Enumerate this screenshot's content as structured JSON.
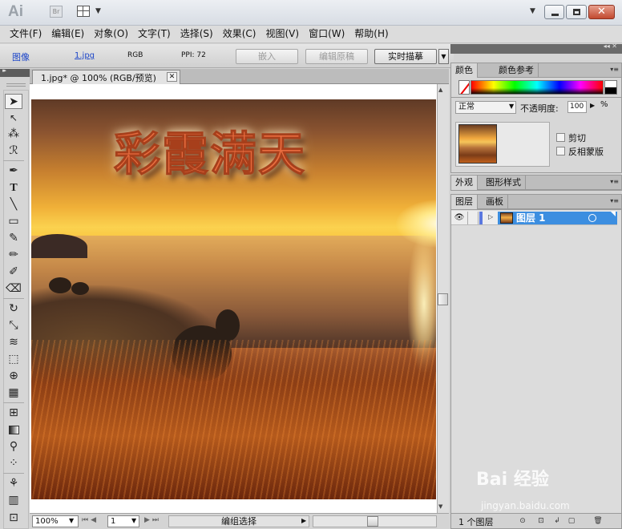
{
  "app": {
    "logo": "Ai",
    "bridge_label": "Br"
  },
  "window": {
    "close_glyph": "✕"
  },
  "menu": [
    "文件(F)",
    "编辑(E)",
    "对象(O)",
    "文字(T)",
    "选择(S)",
    "效果(C)",
    "视图(V)",
    "窗口(W)",
    "帮助(H)"
  ],
  "control_bar": {
    "object_type": "图像",
    "file_link": "1.jpg",
    "color_mode": "RGB",
    "ppi": "PPI: 72",
    "embed_label": "嵌入",
    "edit_original_label": "编辑原稿",
    "live_trace_label": "实时描摹"
  },
  "document": {
    "tab_title": "1.jpg* @ 100% (RGB/预览)",
    "headline": "彩霞满天"
  },
  "status_bar": {
    "zoom": "100%",
    "page": "1",
    "status": "编组选择"
  },
  "panels": {
    "color": {
      "tab_active": "颜色",
      "tab_other": "颜色参考"
    },
    "transparency": {
      "blend_mode": "正常",
      "opacity_label": "不透明度:",
      "opacity_value": "100",
      "opacity_unit": "%",
      "clip_label": "剪切",
      "invert_mask_label": "反相蒙版"
    },
    "appearance": {
      "tab_active": "外观",
      "tab_other": "图形样式"
    },
    "layers": {
      "tab_active": "图层",
      "tab_other": "画板",
      "items": [
        {
          "name": "图层 1"
        }
      ],
      "count_text": "1 个图层"
    }
  },
  "watermark": {
    "brand": "Bai  经验",
    "url": "jingyan.baidu.com"
  },
  "colors": {
    "accent": "#3c8ee0",
    "headline": "#e96c3f"
  }
}
